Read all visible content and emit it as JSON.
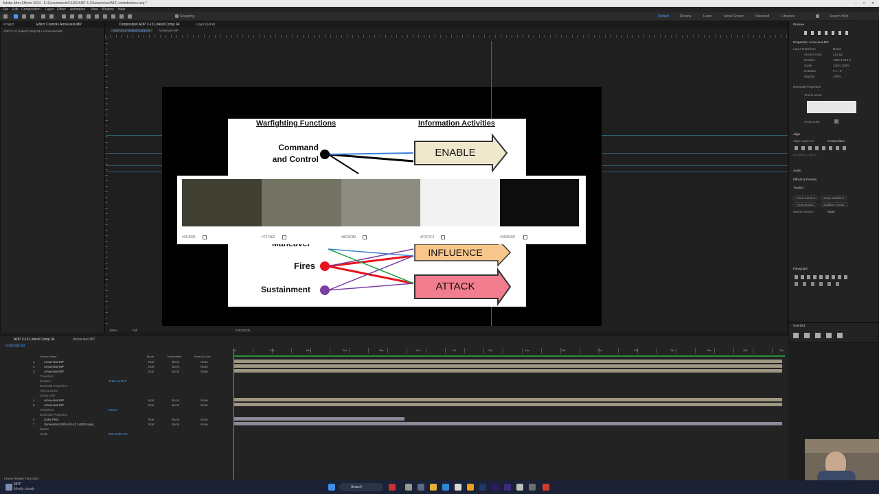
{
  "window": {
    "title": "Adobe After Effects 2024 - E:\\Government\\CADD\\ADP 3-13\\assets\\ae\\WFF-contributions.aep *",
    "controls": [
      "–",
      "□",
      "✕"
    ]
  },
  "menu": [
    "File",
    "Edit",
    "Composition",
    "Layer",
    "Effect",
    "Animation",
    "View",
    "Window",
    "Help"
  ],
  "toolbar": {
    "snapping_label": "Snapping",
    "workspaces": [
      "Default",
      "Review",
      "Learn",
      "Small Screen",
      "Standard",
      "Libraries"
    ],
    "active_workspace": "Default",
    "search_help": "Search Help"
  },
  "project_panel": {
    "tabs": [
      "Project",
      "Effect Controls Arrow-text-MP"
    ],
    "active_tab": "Effect Controls Arrow-text-MP",
    "breadcrumb": "ADP 3-13 Linked Comp 04 • Arrow-text-MP"
  },
  "comp_panel": {
    "tabs": [
      "Composition ADP 3-13 Linked Comp 04",
      "Layer (none)"
    ],
    "subtab": "ADP 3-13 Linked Comp 04",
    "subtab2": "Arrow-text-MP",
    "zoom": "100%",
    "resolution": "Full",
    "timecode": "0:00:00:00"
  },
  "slide": {
    "heading_left": "Warfighting Functions",
    "heading_right": "Information Activities",
    "functions": [
      "Command and Control",
      "Maneuver",
      "Fires",
      "Sustainment"
    ],
    "activities": [
      "ENABLE",
      "INFLUENCE",
      "ATTACK"
    ],
    "colors": {
      "enable_fill": "#efe8cc",
      "influence_fill": "#f8c58a",
      "attack_fill": "#f27d8e",
      "fires_dot": "#e8141c",
      "sustain_dot": "#7b3fa0",
      "c2_dot": "#000000"
    }
  },
  "palette": {
    "swatches": [
      {
        "hex": "#3F4031",
        "color": "#3f4031"
      },
      {
        "hex": "#727362",
        "color": "#727362"
      },
      {
        "hex": "#8C8C80",
        "color": "#8c8c80"
      },
      {
        "hex": "#F2F2F2",
        "color": "#f2f2f2"
      },
      {
        "hex": "#0D0D0D",
        "color": "#0d0d0d"
      }
    ]
  },
  "right_panel": {
    "preview_label": "Preview",
    "properties_title": "Properties: Arrow-text-MP",
    "layer_transform": "Layer Transform",
    "reset": "Reset",
    "props": [
      {
        "name": "Anchor Point",
        "value": "213   82"
      },
      {
        "name": "Position",
        "value": "1196.1   579.2"
      },
      {
        "name": "Scale",
        "value": "100%   100%"
      },
      {
        "name": "Rotation",
        "value": "0 x +0°"
      },
      {
        "name": "Opacity",
        "value": "100%"
      }
    ],
    "essential_properties": "Essential Properties",
    "text_in_arrow": "Text in arrow",
    "arrow_color": "Arrow color",
    "align": "Align",
    "align_layers_to": "Align Layers to:",
    "align_target": "Composition",
    "distribute_layers": "Distribute Layers:",
    "audio": "Audio",
    "effects_presets": "Effects & Presets",
    "tracker": "Tracker",
    "tracker_buttons": [
      "Track Camera",
      "Warp Stabilizer",
      "Track Motion",
      "Stabilize Motion"
    ],
    "motion_source": "Motion Source:",
    "motion_source_value": "None",
    "paragraph": "Paragraph",
    "overlord": "Overlord"
  },
  "timeline": {
    "tabs": [
      "ADP 3-13 Linked Comp 04",
      "Arrow-text-MP"
    ],
    "timecode": "0:00:00:00",
    "columns": [
      "Source Name",
      "Mode",
      "Track Matte",
      "Parent & Link"
    ],
    "layers": [
      {
        "num": "1",
        "name": "Arrow-text-MP",
        "mode": "Norr",
        "matte": "No M",
        "parent": "None"
      },
      {
        "num": "2",
        "name": "Arrow-text-MP",
        "mode": "Norr",
        "matte": "No M",
        "parent": "None"
      },
      {
        "num": "3",
        "name": "Arrow-text-MP",
        "mode": "Norr",
        "matte": "No M",
        "parent": "None"
      },
      {
        "num": "",
        "name": "Transform",
        "mode": "",
        "matte": "",
        "parent": ""
      },
      {
        "num": "",
        "name": "Position",
        "mode": "1196.1,579.2",
        "matte": "",
        "parent": ""
      },
      {
        "num": "",
        "name": "Essential Properties",
        "mode": "",
        "matte": "",
        "parent": ""
      },
      {
        "num": "",
        "name": "Text in arrow",
        "mode": "",
        "matte": "",
        "parent": ""
      },
      {
        "num": "",
        "name": "Arrow color",
        "mode": "",
        "matte": "",
        "parent": ""
      },
      {
        "num": "4",
        "name": "Arrow-text-MP",
        "mode": "Norr",
        "matte": "No M",
        "parent": "None"
      },
      {
        "num": "5",
        "name": "Arrow-text-MP",
        "mode": "Norr",
        "matte": "No M",
        "parent": "None"
      },
      {
        "num": "",
        "name": "Transform",
        "mode": "Reset",
        "matte": "",
        "parent": ""
      },
      {
        "num": "",
        "name": "Essential Properties",
        "mode": "",
        "matte": "",
        "parent": ""
      },
      {
        "num": "6",
        "name": "Color.PNG",
        "mode": "Norr",
        "matte": "No M",
        "parent": "None"
      },
      {
        "num": "7",
        "name": "Screenshot 2024-03-12 145226.png",
        "mode": "Norr",
        "matte": "No M",
        "parent": "None"
      },
      {
        "num": "",
        "name": "Masks",
        "mode": "",
        "matte": "",
        "parent": ""
      },
      {
        "num": "",
        "name": "Scale",
        "mode": "255.5,255.5%",
        "matte": "",
        "parent": ""
      }
    ],
    "ticks": [
      "0s",
      "02s",
      "04s",
      "06s",
      "08s",
      "10s",
      "12s",
      "14s",
      "16s",
      "18s",
      "20s",
      "22s",
      "24s",
      "26s",
      "28s",
      "30s"
    ],
    "footer": "Frame Render Time  0ms"
  },
  "taskbar": {
    "weather_temp": "65°F",
    "weather_desc": "Mostly cloudy",
    "search": "Search"
  }
}
